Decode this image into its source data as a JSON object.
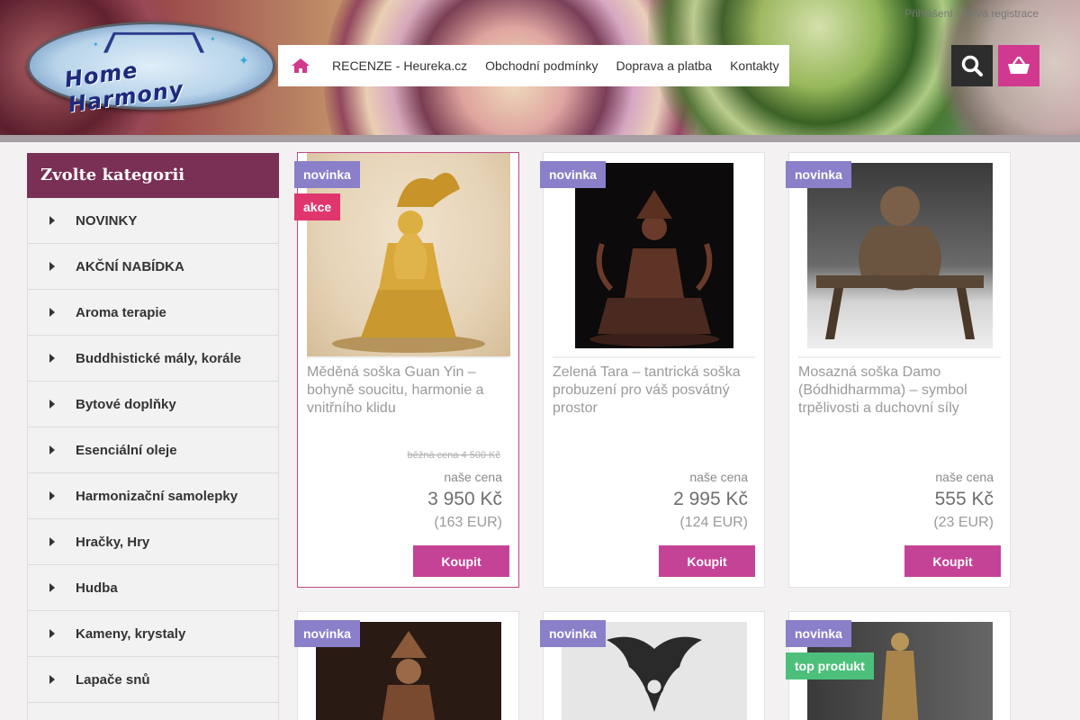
{
  "header": {
    "logo_text": "Home Harmony",
    "top_links": [
      "Přihlášení",
      "Nová registrace"
    ],
    "nav": [
      "RECENZE - Heureka.cz",
      "Obchodní podmínky",
      "Doprava a platba",
      "Kontakty"
    ],
    "home_icon": "home-icon",
    "search_icon": "search-icon",
    "cart_icon": "basket-icon"
  },
  "sidebar": {
    "title": "Zvolte kategorii",
    "items": [
      "NOVINKY",
      "AKČNÍ NABÍDKA",
      "Aroma terapie",
      "Buddhistické mály, korále",
      "Bytové doplňky",
      "Esenciální oleje",
      "Harmonizační samolepky",
      "Hračky, Hry",
      "Hudba",
      "Kameny, krystaly",
      "Lapače snů",
      ""
    ]
  },
  "products": [
    {
      "badges": [
        "novinka",
        "akce"
      ],
      "name": "Měděná soška Guan Yin – bohyně soucitu, harmonie a vnitřního klidu",
      "old_price": "běžná cena 4 500 Kč",
      "price_label": "naše cena",
      "price": "3 950 Kč",
      "eur": "(163 EUR)",
      "buy": "Koupit"
    },
    {
      "badges": [
        "novinka"
      ],
      "name": "Zelená Tara – tantrická soška probuzení pro váš posvátný prostor",
      "old_price": "",
      "price_label": "naše cena",
      "price": "2 995 Kč",
      "eur": "(124 EUR)",
      "buy": "Koupit"
    },
    {
      "badges": [
        "novinka"
      ],
      "name": "Mosazná soška Damo (Bódhidharmma) – symbol trpělivosti a duchovní síly",
      "old_price": "",
      "price_label": "naše cena",
      "price": "555 Kč",
      "eur": "(23 EUR)",
      "buy": "Koupit"
    },
    {
      "badges": [
        "novinka"
      ]
    },
    {
      "badges": [
        "novinka"
      ]
    },
    {
      "badges": [
        "novinka",
        "top produkt"
      ]
    }
  ],
  "colors": {
    "accent": "#c54396",
    "sidebar_title_bg": "#7a2f55",
    "badge_new": "#8a7fc9",
    "badge_sale": "#e0366e",
    "badge_top": "#4cc07a"
  }
}
